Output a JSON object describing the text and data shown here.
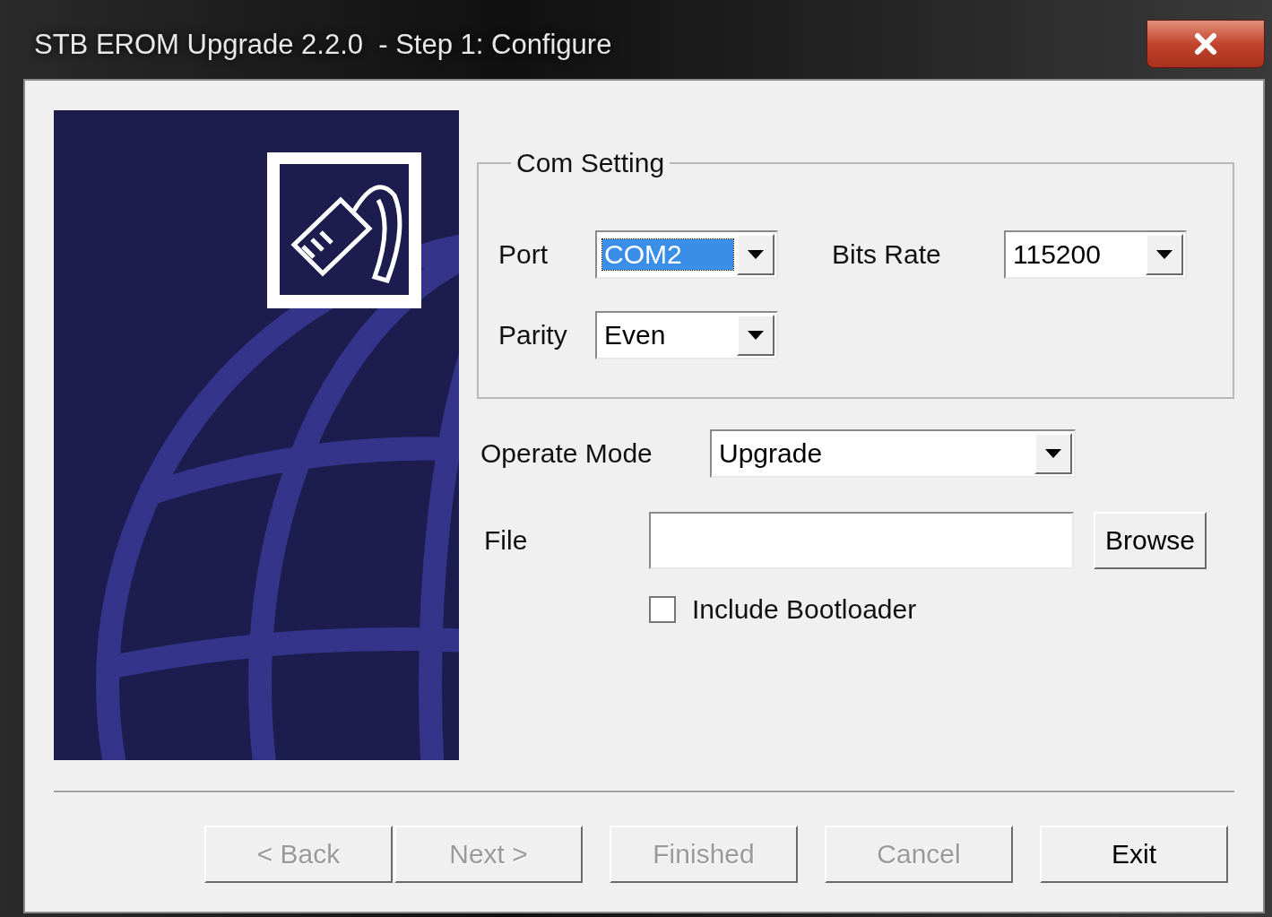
{
  "window": {
    "title": "STB EROM Upgrade 2.2.0  - Step 1: Configure"
  },
  "com_setting": {
    "title": "Com Setting",
    "fields": [
      {
        "label": "Port",
        "value": "COM2",
        "selected": true
      },
      {
        "label": "Bits Rate",
        "value": "115200",
        "selected": false
      },
      {
        "label": "Parity",
        "value": "Even",
        "selected": false
      }
    ]
  },
  "operate_mode": {
    "label": "Operate Mode",
    "value": "Upgrade"
  },
  "file": {
    "label": "File"
  },
  "browse_button": "Browse",
  "include_bootloader": {
    "label": "Include Bootloader",
    "checked": false
  },
  "buttons": [
    {
      "label": "< Back",
      "disabled": true
    },
    {
      "label": "Next >",
      "disabled": true
    },
    {
      "label": "Finished",
      "disabled": true
    },
    {
      "label": "Cancel",
      "disabled": true
    },
    {
      "label": "Exit",
      "disabled": false
    }
  ]
}
